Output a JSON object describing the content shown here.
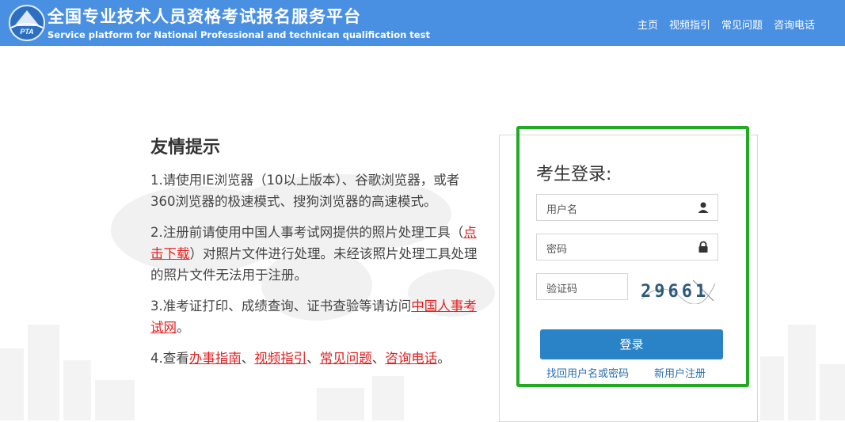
{
  "header": {
    "logo_text": "PTA",
    "title_cn": "全国专业技术人员资格考试报名服务平台",
    "title_en": "Service platform for National Professional and technican qualification test",
    "nav": [
      "主页",
      "视频指引",
      "常见问题",
      "咨询电话"
    ]
  },
  "tips": {
    "title": "友情提示",
    "tip1": "1.请使用IE浏览器（10以上版本）、谷歌浏览器，或者360浏览器的极速模式、搜狗浏览器的高速模式。",
    "tip2_a": "2.注册前请使用中国人事考试网提供的照片处理工具（",
    "tip2_link": "点击下载",
    "tip2_b": "）对照片文件进行处理。未经该照片处理工具处理的照片文件无法用于注册。",
    "tip3_a": "3.准考证打印、成绩查询、证书查验等请访问",
    "tip3_link": "中国人事考试网",
    "tip3_b": "。",
    "tip4_a": "4.查看",
    "tip4_links": [
      "办事指南",
      "视频指引",
      "常见问题",
      "咨询电话"
    ],
    "tip4_sep": "、",
    "tip4_end": "。"
  },
  "login": {
    "title": "考生登录:",
    "username_placeholder": "用户名",
    "password_placeholder": "密码",
    "captcha_placeholder": "验证码",
    "captcha_code": "29661",
    "submit_label": "登录",
    "recover_link": "找回用户名或密码",
    "register_link": "新用户注册"
  },
  "colors": {
    "header_bg": "#4a90e2",
    "highlight_border": "#22aa22",
    "link_red": "#e02020",
    "button_blue": "#2b83c7"
  }
}
